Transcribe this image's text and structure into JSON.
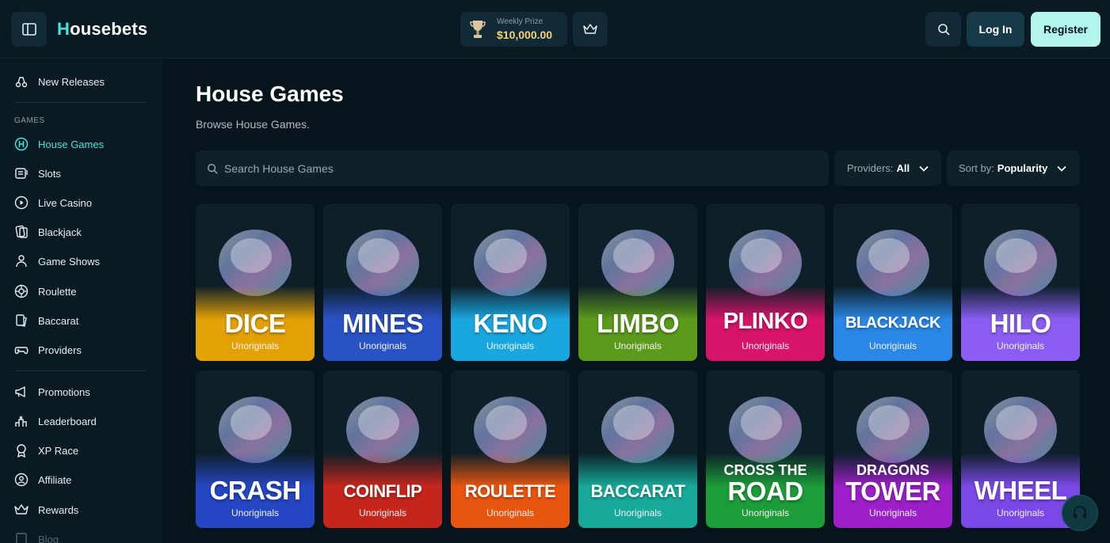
{
  "header": {
    "logo_initial": "H",
    "logo_rest": "ousebets",
    "prize_label": "Weekly Prize",
    "prize_amount": "$10,000.00",
    "login_label": "Log In",
    "register_label": "Register"
  },
  "sidebar": {
    "top_item": "New Releases",
    "section_label": "GAMES",
    "games": [
      "House Games",
      "Slots",
      "Live Casino",
      "Blackjack",
      "Game Shows",
      "Roulette",
      "Baccarat",
      "Providers"
    ],
    "more": [
      "Promotions",
      "Leaderboard",
      "XP Race",
      "Affiliate",
      "Rewards",
      "Blog"
    ]
  },
  "main": {
    "title": "House Games",
    "subtitle": "Browse House Games.",
    "search_placeholder": "Search House Games",
    "providers_label": "Providers:",
    "providers_value": "All",
    "sort_label": "Sort by:",
    "sort_value": "Popularity"
  },
  "cards": [
    {
      "pre": "",
      "name": "DICE",
      "provider": "Unoriginals",
      "color": "#e3a106"
    },
    {
      "pre": "",
      "name": "MINES",
      "provider": "Unoriginals",
      "color": "#2a52c7"
    },
    {
      "pre": "",
      "name": "KENO",
      "provider": "Unoriginals",
      "color": "#1aa7e0"
    },
    {
      "pre": "",
      "name": "LIMBO",
      "provider": "Unoriginals",
      "color": "#5c9a1c"
    },
    {
      "pre": "",
      "name": "PLINKO",
      "provider": "Unoriginals",
      "color": "#d8146a"
    },
    {
      "pre": "",
      "name": "BLACKJACK",
      "provider": "Unoriginals",
      "color": "#2a87e6"
    },
    {
      "pre": "",
      "name": "HILO",
      "provider": "Unoriginals",
      "color": "#8b5df2"
    },
    {
      "pre": "",
      "name": "CRASH",
      "provider": "Unoriginals",
      "color": "#2546c2"
    },
    {
      "pre": "",
      "name": "COINFLIP",
      "provider": "Unoriginals",
      "color": "#c4261c"
    },
    {
      "pre": "",
      "name": "ROULETTE",
      "provider": "Unoriginals",
      "color": "#e8550f"
    },
    {
      "pre": "",
      "name": "BACCARAT",
      "provider": "Unoriginals",
      "color": "#17a99a"
    },
    {
      "pre": "CROSS THE",
      "name": "ROAD",
      "provider": "Unoriginals",
      "color": "#1d9c3a"
    },
    {
      "pre": "DRAGONS",
      "name": "TOWER",
      "provider": "Unoriginals",
      "color": "#9c1fc7"
    },
    {
      "pre": "",
      "name": "WHEEL",
      "provider": "Unoriginals",
      "color": "#7b48e8"
    }
  ],
  "icons": {
    "sidebar_toggle": "sidebar-toggle-icon",
    "trophy": "trophy-icon",
    "crown": "crown-icon",
    "search": "search-icon",
    "support": "headset-icon"
  }
}
